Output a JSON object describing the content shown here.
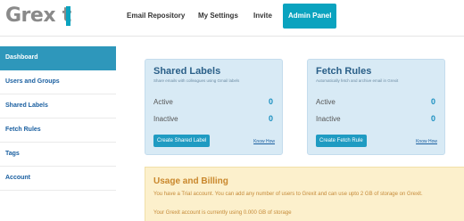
{
  "logo": {
    "text_prefix": "Grex",
    "text_i": "I",
    "text_suffix": "t"
  },
  "nav": {
    "items": [
      {
        "label": "Email Repository"
      },
      {
        "label": "My Settings"
      },
      {
        "label": "Invite"
      },
      {
        "label": "Admin Panel"
      }
    ]
  },
  "sidebar": {
    "items": [
      {
        "label": "Dashboard"
      },
      {
        "label": "Users and Groups"
      },
      {
        "label": "Shared Labels"
      },
      {
        "label": "Fetch Rules"
      },
      {
        "label": "Tags"
      },
      {
        "label": "Account"
      }
    ]
  },
  "cards": {
    "shared_labels": {
      "title": "Shared Labels",
      "subtitle": "Share emails with colleagues using Gmail labels",
      "active_label": "Active",
      "active_value": "0",
      "inactive_label": "Inactive",
      "inactive_value": "0",
      "button": "Create Shared Label",
      "link": "Know How"
    },
    "fetch_rules": {
      "title": "Fetch Rules",
      "subtitle": "Automatically fetch and archive email in Grexit",
      "active_label": "Active",
      "active_value": "0",
      "inactive_label": "Inactive",
      "inactive_value": "0",
      "button": "Create Fetch Rule",
      "link": "Know How"
    }
  },
  "usage": {
    "title": "Usage and Billing",
    "line1": "You have a Trial account. You can add any number of users to Grexit and can use upto 2 GB of storage on Grexit.",
    "line2": "Your Grexit account is currently using 0.000 GB of storage"
  },
  "colors": {
    "accent": "#0aa3bf",
    "sidebar_active": "#2e97bb",
    "card_bg": "#d8eaf5",
    "usage_bg": "#fcf0cc"
  }
}
